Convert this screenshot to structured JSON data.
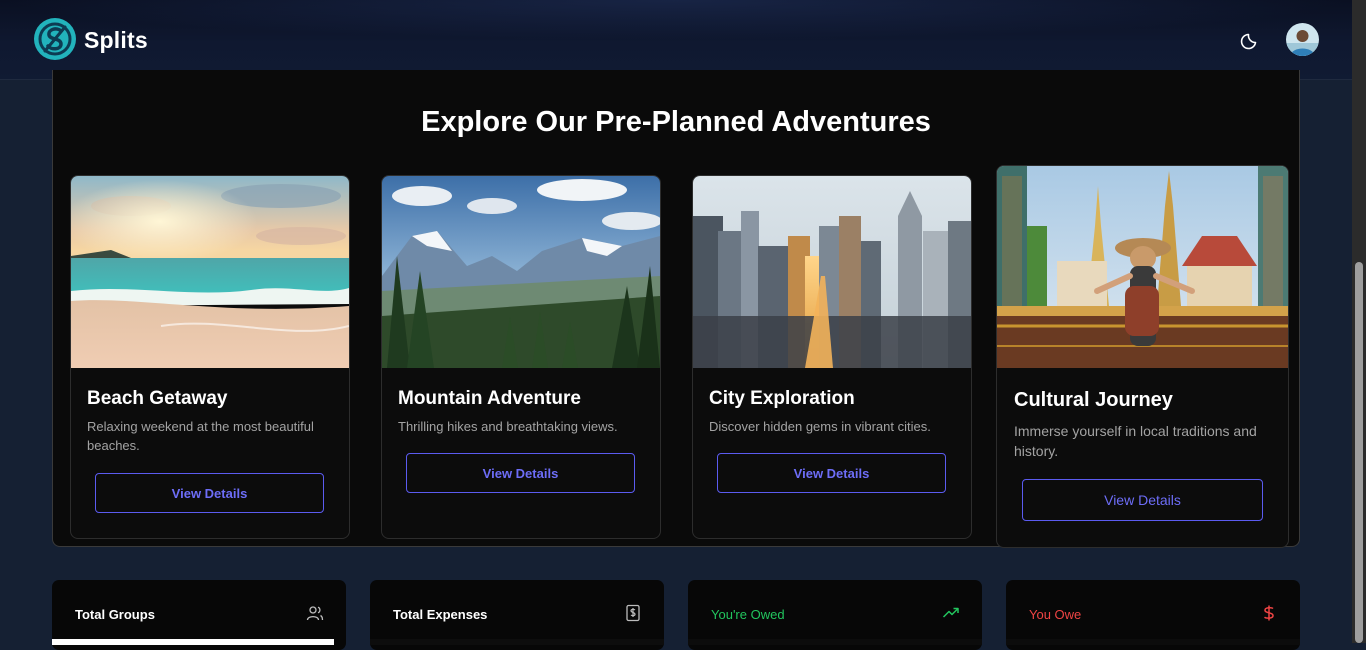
{
  "app": {
    "brand": "Splits",
    "logo_icon": "splits-dollar-logo-icon",
    "theme_icon": "moon-icon",
    "avatar_icon": "user-avatar"
  },
  "colors": {
    "accent": "#5b5bf0",
    "owed": "#22c55e",
    "owe": "#ef4444",
    "logo_teal": "#22b3bc"
  },
  "adventures": {
    "title": "Explore Our Pre-Planned Adventures",
    "cards": [
      {
        "title": "Beach Getaway",
        "description": "Relaxing weekend at the most beautiful beaches.",
        "button": "View Details",
        "image": "beach-sunset-image"
      },
      {
        "title": "Mountain Adventure",
        "description": "Thrilling hikes and breathtaking views.",
        "button": "View Details",
        "image": "mountain-valley-image"
      },
      {
        "title": "City Exploration",
        "description": "Discover hidden gems in vibrant cities.",
        "button": "View Details",
        "image": "city-skyline-image"
      },
      {
        "title": "Cultural Journey",
        "description": "Immerse yourself in local traditions and history.",
        "button": "View Details",
        "image": "temple-traveler-image"
      }
    ]
  },
  "stats": [
    {
      "label": "Total Groups",
      "icon": "users-icon"
    },
    {
      "label": "Total Expenses",
      "icon": "receipt-dollar-icon"
    },
    {
      "label": "You're Owed",
      "icon": "trending-up-icon"
    },
    {
      "label": "You Owe",
      "icon": "dollar-icon"
    }
  ]
}
